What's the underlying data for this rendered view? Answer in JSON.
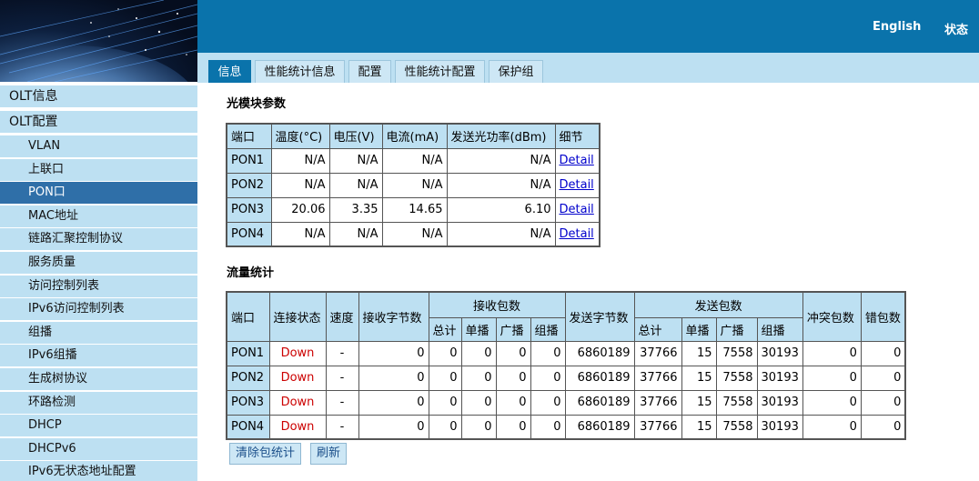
{
  "header": {
    "links": [
      "English",
      "状态"
    ]
  },
  "tabs": [
    "信息",
    "性能统计信息",
    "配置",
    "性能统计配置",
    "保护组"
  ],
  "sidebar": {
    "items": [
      {
        "label": "OLT信息",
        "level": "top",
        "active": false
      },
      {
        "label": "OLT配置",
        "level": "top",
        "active": false
      },
      {
        "label": "VLAN",
        "level": "sub",
        "active": false
      },
      {
        "label": "上联口",
        "level": "sub",
        "active": false
      },
      {
        "label": "PON口",
        "level": "sub",
        "active": true
      },
      {
        "label": "MAC地址",
        "level": "sub",
        "active": false
      },
      {
        "label": "链路汇聚控制协议",
        "level": "sub",
        "active": false
      },
      {
        "label": "服务质量",
        "level": "sub",
        "active": false
      },
      {
        "label": "访问控制列表",
        "level": "sub",
        "active": false
      },
      {
        "label": "IPv6访问控制列表",
        "level": "sub",
        "active": false
      },
      {
        "label": "组播",
        "level": "sub",
        "active": false
      },
      {
        "label": "IPv6组播",
        "level": "sub",
        "active": false
      },
      {
        "label": "生成树协议",
        "level": "sub",
        "active": false
      },
      {
        "label": "环路检测",
        "level": "sub",
        "active": false
      },
      {
        "label": "DHCP",
        "level": "sub",
        "active": false
      },
      {
        "label": "DHCPv6",
        "level": "sub",
        "active": false
      },
      {
        "label": "IPv6无状态地址配置",
        "level": "sub",
        "active": false
      }
    ]
  },
  "optical": {
    "title": "光模块参数",
    "headers": [
      "端口",
      "温度(°C)",
      "电压(V)",
      "电流(mA)",
      "发送光功率(dBm)",
      "细节"
    ],
    "rows": [
      [
        "PON1",
        "N/A",
        "N/A",
        "N/A",
        "N/A",
        "Detail"
      ],
      [
        "PON2",
        "N/A",
        "N/A",
        "N/A",
        "N/A",
        "Detail"
      ],
      [
        "PON3",
        "20.06",
        "3.35",
        "14.65",
        "6.10",
        "Detail"
      ],
      [
        "PON4",
        "N/A",
        "N/A",
        "N/A",
        "N/A",
        "Detail"
      ]
    ]
  },
  "traffic": {
    "title": "流量统计",
    "headers": {
      "port": "端口",
      "link": "连接状态",
      "speed": "速度",
      "rx_bytes": "接收字节数",
      "rx_packets": "接收包数",
      "tx_bytes": "发送字节数",
      "tx_packets": "发送包数",
      "collisions": "冲突包数",
      "errors": "错包数",
      "sub": [
        "总计",
        "单播",
        "广播",
        "组播"
      ]
    },
    "rows": [
      [
        "PON1",
        "Down",
        "-",
        "0",
        "0",
        "0",
        "0",
        "0",
        "6860189",
        "37766",
        "15",
        "7558",
        "30193",
        "0",
        "0"
      ],
      [
        "PON2",
        "Down",
        "-",
        "0",
        "0",
        "0",
        "0",
        "0",
        "6860189",
        "37766",
        "15",
        "7558",
        "30193",
        "0",
        "0"
      ],
      [
        "PON3",
        "Down",
        "-",
        "0",
        "0",
        "0",
        "0",
        "0",
        "6860189",
        "37766",
        "15",
        "7558",
        "30193",
        "0",
        "0"
      ],
      [
        "PON4",
        "Down",
        "-",
        "0",
        "0",
        "0",
        "0",
        "0",
        "6860189",
        "37766",
        "15",
        "7558",
        "30193",
        "0",
        "0"
      ]
    ]
  },
  "buttons": {
    "clear": "清除包统计",
    "refresh": "刷新"
  }
}
